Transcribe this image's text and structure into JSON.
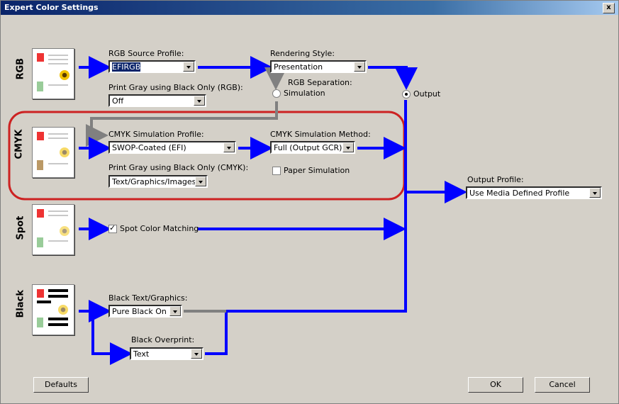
{
  "window": {
    "title": "Expert Color Settings",
    "close_label": "x"
  },
  "rows": {
    "rgb": "RGB",
    "cmyk": "CMYK",
    "spot": "Spot",
    "black": "Black"
  },
  "rgb": {
    "source_label": "RGB Source Profile:",
    "source_value": "EFIRGB",
    "gray_label": "Print Gray using Black Only (RGB):",
    "gray_value": "Off",
    "rendering_label": "Rendering Style:",
    "rendering_value": "Presentation",
    "separation_label": "RGB Separation:",
    "simulation_label": "Simulation",
    "output_label": "Output"
  },
  "cmyk": {
    "profile_label": "CMYK Simulation Profile:",
    "profile_value": "SWOP-Coated (EFI)",
    "gray_label": "Print Gray using Black Only (CMYK):",
    "gray_value": "Text/Graphics/Images",
    "method_label": "CMYK Simulation Method:",
    "method_value": "Full (Output GCR)",
    "paper_label": "Paper Simulation"
  },
  "spot": {
    "matching_label": "Spot Color Matching",
    "matching_checked": true
  },
  "black": {
    "text_label": "Black Text/Graphics:",
    "text_value": "Pure Black On",
    "overprint_label": "Black Overprint:",
    "overprint_value": "Text"
  },
  "output": {
    "profile_label": "Output Profile:",
    "profile_value": "Use Media Defined Profile"
  },
  "buttons": {
    "defaults": "Defaults",
    "ok": "OK",
    "cancel": "Cancel"
  },
  "colors": {
    "flow_blue": "#0000ff",
    "flow_gray": "#808080",
    "highlight_red": "#cc2222",
    "titlebar": "#0a246a"
  }
}
